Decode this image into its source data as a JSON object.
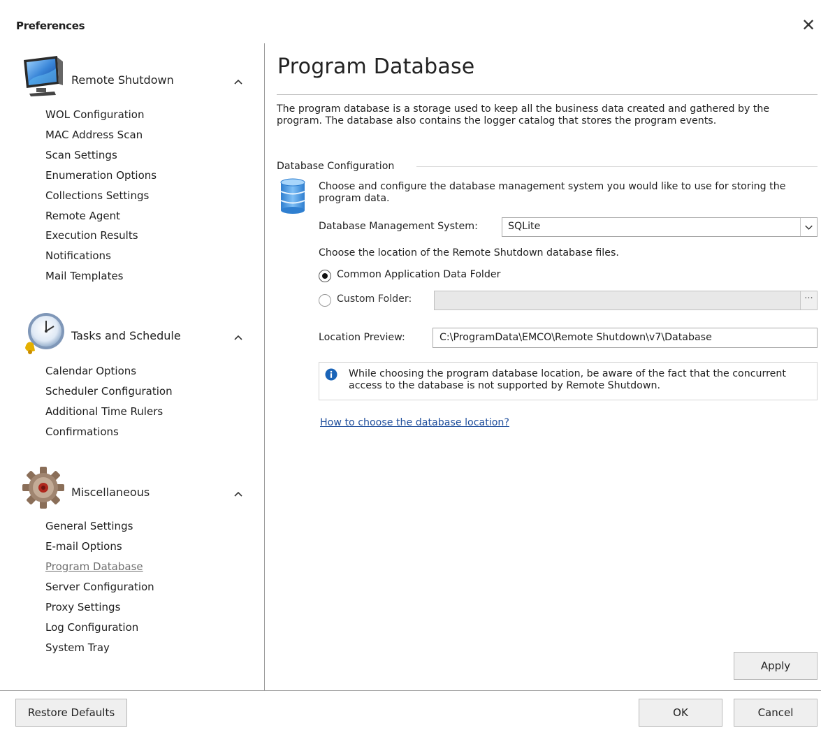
{
  "window": {
    "title": "Preferences",
    "close_glyph": "✕"
  },
  "sidebar": {
    "groups": [
      {
        "title": "Remote Shutdown",
        "icon": "monitor-icon",
        "items": [
          "WOL Configuration",
          "MAC Address Scan",
          "Scan Settings",
          "Enumeration Options",
          "Collections Settings",
          "Remote Agent",
          "Execution Results",
          "Notifications",
          "Mail Templates"
        ]
      },
      {
        "title": "Tasks and Schedule",
        "icon": "clock-icon",
        "items": [
          "Calendar Options",
          "Scheduler Configuration",
          "Additional Time Rulers",
          "Confirmations"
        ]
      },
      {
        "title": "Miscellaneous",
        "icon": "gear-icon",
        "items": [
          "General Settings",
          "E-mail Options",
          "Program Database",
          "Server Configuration",
          "Proxy Settings",
          "Log Configuration",
          "System Tray"
        ]
      }
    ],
    "active_item": "Program Database"
  },
  "content": {
    "title": "Program Database",
    "description": "The program database is a storage used to keep all the business data created and gathered by the program. The database also contains the logger catalog that stores the program events.",
    "section_label": "Database Configuration",
    "config_text": "Choose and configure the database management system you would like to use for storing the program data.",
    "dbms_label": "Database Management System:",
    "dbms_value": "SQLite",
    "location_text": "Choose the location of the Remote Shutdown database files.",
    "radio_common": "Common Application Data Folder",
    "radio_custom": "Custom Folder:",
    "selected_location": "common",
    "browse_label": "···",
    "preview_label": "Location Preview:",
    "preview_value": "C:\\ProgramData\\EMCO\\Remote Shutdown\\v7\\Database",
    "info_text": "While choosing the program database location, be aware of the fact that the concurrent access to the database is not supported by Remote Shutdown.",
    "help_link": "How to choose the database location?",
    "apply_label": "Apply"
  },
  "footer": {
    "restore_label": "Restore Defaults",
    "ok_label": "OK",
    "cancel_label": "Cancel"
  },
  "colors": {
    "link": "#1f4e9c",
    "active_nav": "#707070"
  }
}
